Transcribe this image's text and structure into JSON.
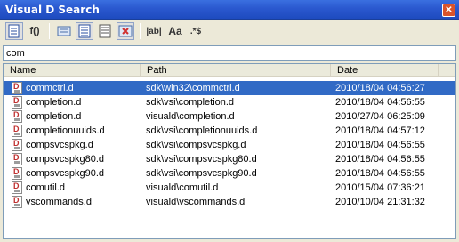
{
  "window": {
    "title": "Visual D Search",
    "close_glyph": "✕"
  },
  "toolbar": {
    "buttons": [
      {
        "icon": "document-icon",
        "label": ""
      },
      {
        "icon": "function-icon",
        "label": "f()"
      },
      {
        "icon": "view-list-icon",
        "label": ""
      },
      {
        "icon": "view-details-icon",
        "label": ""
      },
      {
        "icon": "view-columns-icon",
        "label": ""
      },
      {
        "icon": "close-search-icon",
        "label": ""
      },
      {
        "icon": "whole-word-icon",
        "label": "|ab|"
      },
      {
        "icon": "case-sensitive-icon",
        "label": "Aa"
      },
      {
        "icon": "regex-icon",
        "label": ".*$"
      }
    ]
  },
  "search": {
    "value": "com"
  },
  "columns": {
    "name": "Name",
    "path": "Path",
    "date": "Date"
  },
  "rows": [
    {
      "name": "commctrl.d",
      "path": "sdk\\win32\\commctrl.d",
      "date": "2010/18/04 04:56:27",
      "selected": true
    },
    {
      "name": "completion.d",
      "path": "sdk\\vsi\\completion.d",
      "date": "2010/18/04 04:56:55"
    },
    {
      "name": "completion.d",
      "path": "visuald\\completion.d",
      "date": "2010/27/04 06:25:09"
    },
    {
      "name": "completionuuids.d",
      "path": "sdk\\vsi\\completionuuids.d",
      "date": "2010/18/04 04:57:12"
    },
    {
      "name": "compsvcspkg.d",
      "path": "sdk\\vsi\\compsvcspkg.d",
      "date": "2010/18/04 04:56:55"
    },
    {
      "name": "compsvcspkg80.d",
      "path": "sdk\\vsi\\compsvcspkg80.d",
      "date": "2010/18/04 04:56:55"
    },
    {
      "name": "compsvcspkg90.d",
      "path": "sdk\\vsi\\compsvcspkg90.d",
      "date": "2010/18/04 04:56:55"
    },
    {
      "name": "comutil.d",
      "path": "visuald\\comutil.d",
      "date": "2010/15/04 07:36:21"
    },
    {
      "name": "vscommands.d",
      "path": "visuald\\vscommands.d",
      "date": "2010/10/04 21:31:32"
    }
  ],
  "colors": {
    "titlebar": "#2a58cf",
    "selection": "#316ac5",
    "window_bg": "#ece9d8"
  }
}
